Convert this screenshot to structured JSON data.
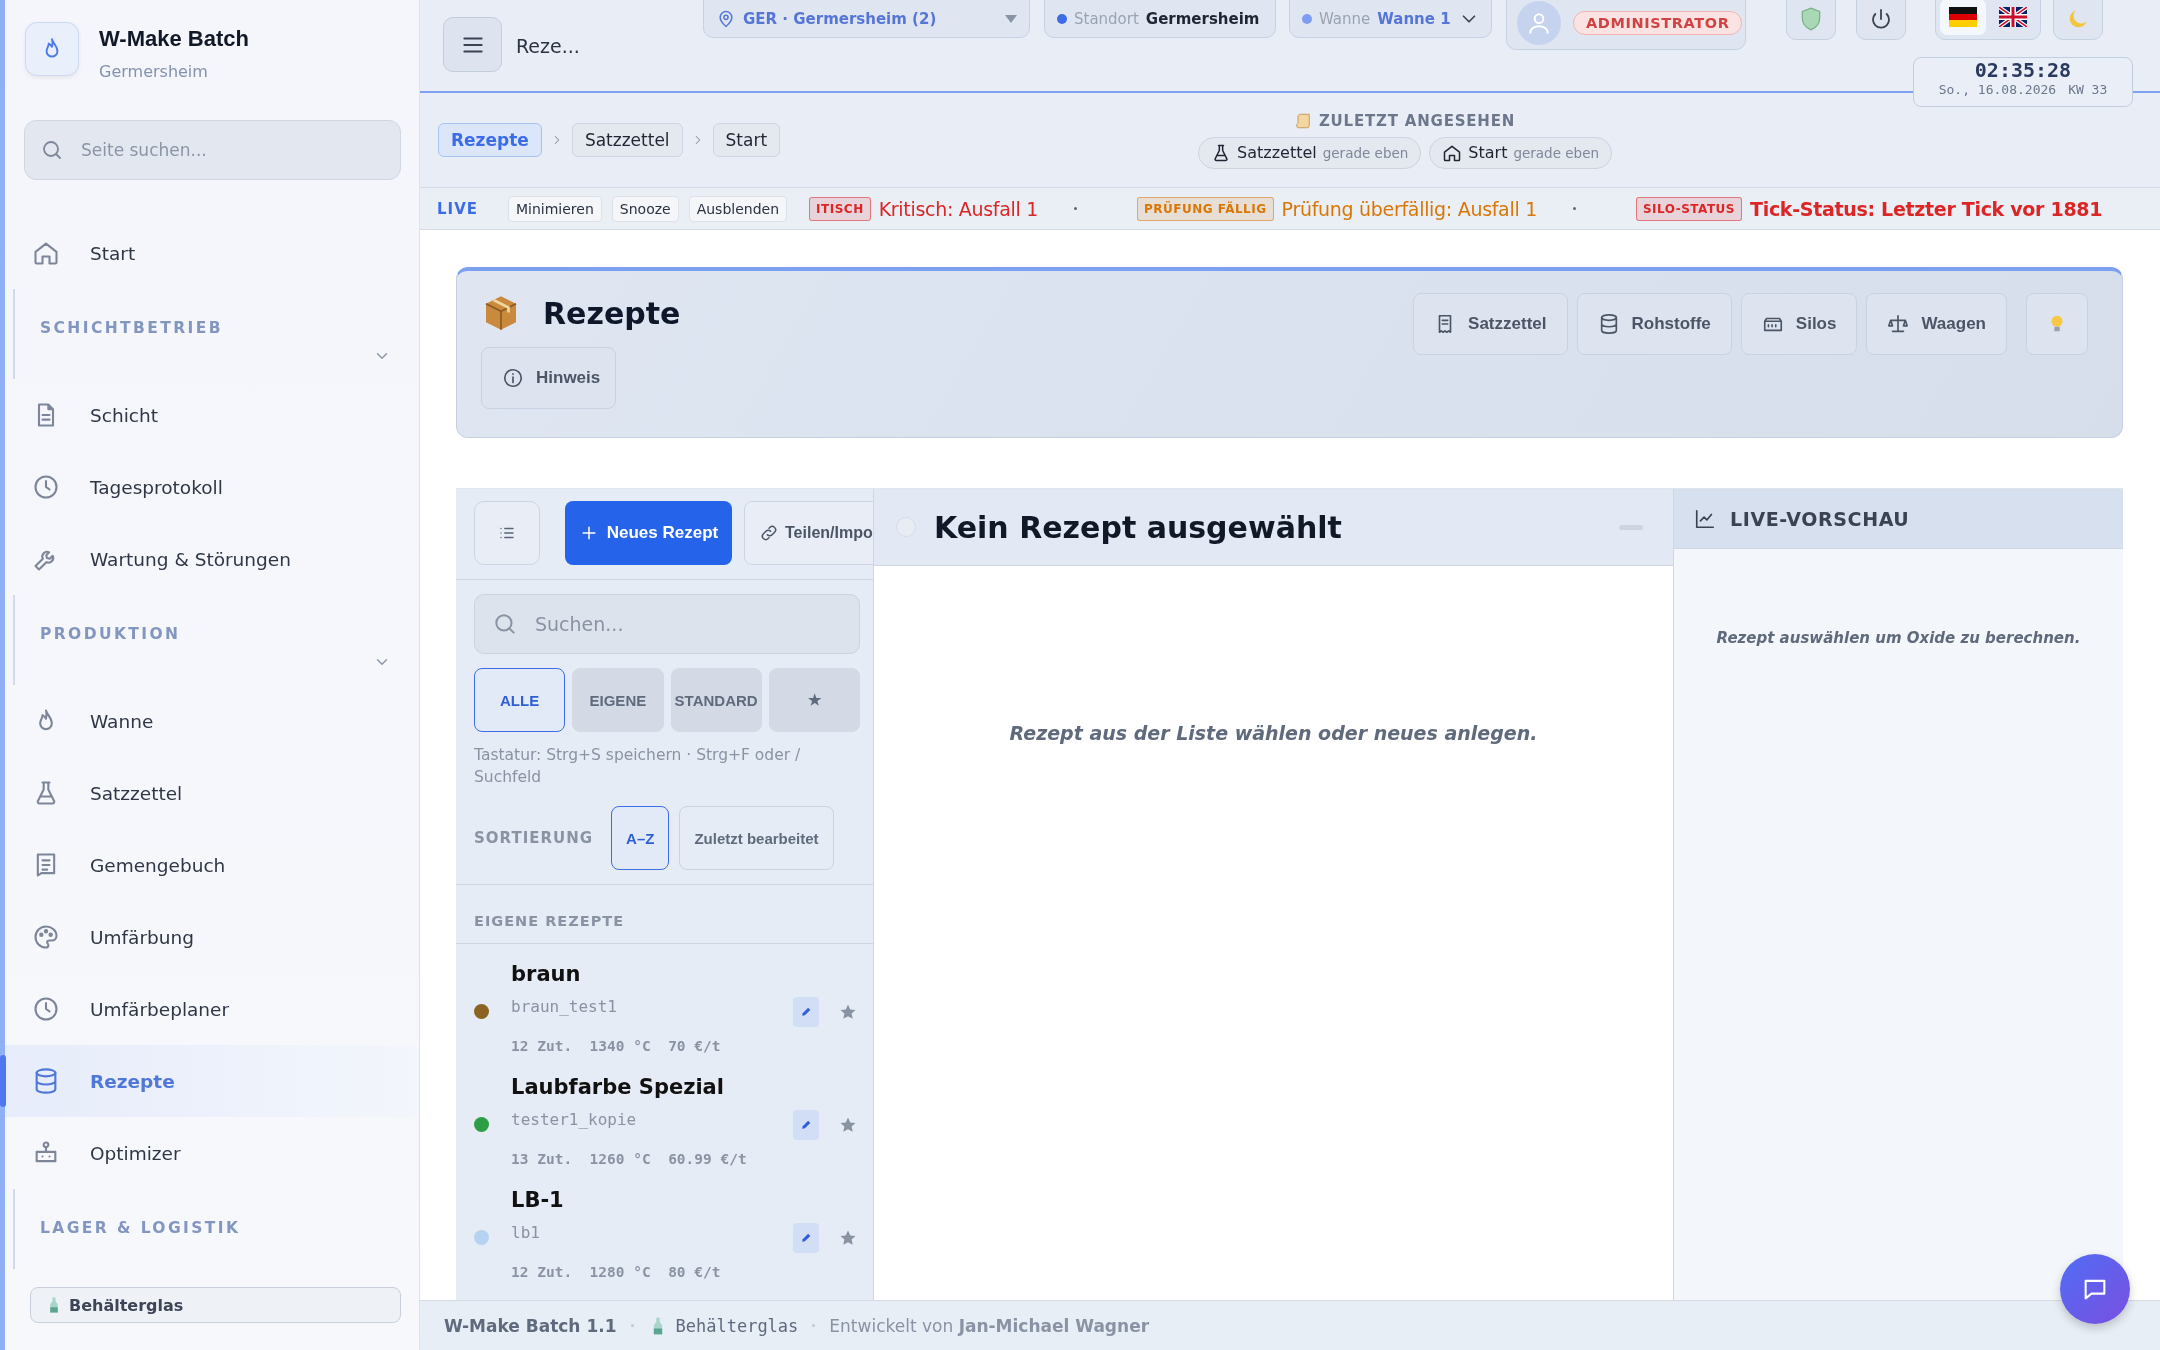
{
  "app": {
    "title": "W-Make Batch",
    "subtitle": "Germersheim"
  },
  "sidebar": {
    "search": {
      "placeholder": "Seite suchen..."
    },
    "nav": [
      {
        "kind": "link",
        "label": "Start",
        "selected": false
      },
      {
        "kind": "section",
        "label": "SCHICHTBETRIEB",
        "expanded": true
      },
      {
        "kind": "link",
        "label": "Schicht",
        "selected": false
      },
      {
        "kind": "link",
        "label": "Tagesprotokoll",
        "selected": false
      },
      {
        "kind": "link",
        "label": "Wartung & Störungen",
        "selected": false
      },
      {
        "kind": "section",
        "label": "PRODUKTION",
        "expanded": true
      },
      {
        "kind": "link",
        "label": "Wanne",
        "selected": false
      },
      {
        "kind": "link",
        "label": "Satzzettel",
        "selected": false
      },
      {
        "kind": "link",
        "label": "Gemengebuch",
        "selected": false
      },
      {
        "kind": "link",
        "label": "Umfärbung",
        "selected": false
      },
      {
        "kind": "link",
        "label": "Umfärbeplaner",
        "selected": false
      },
      {
        "kind": "link",
        "label": "Rezepte",
        "selected": true
      },
      {
        "kind": "link",
        "label": "Optimizer",
        "selected": false
      },
      {
        "kind": "section",
        "label": "LAGER & LOGISTIK",
        "expanded": false
      }
    ],
    "material_button": "Behälterglas"
  },
  "topbar": {
    "page_title": "Reze...",
    "location": "GER · Germersheim (2)",
    "standort": {
      "label": "Standort",
      "value": "Germersheim"
    },
    "wanne": {
      "label": "Wanne",
      "value": "Wanne 1"
    },
    "role": "ADMINISTRATOR",
    "languages": [
      {
        "selected": true
      },
      {
        "selected": false
      }
    ],
    "clock": {
      "time": "02:35:28",
      "date": "So., 16.08.2026",
      "week": "KW 33"
    }
  },
  "breadcrumbs": [
    {
      "label": "Rezepte",
      "selected": true
    },
    {
      "label": "Satzzettel",
      "selected": false
    },
    {
      "label": "Start",
      "selected": false
    }
  ],
  "recent": {
    "title": "ZULETZT ANGESEHEN",
    "items": [
      {
        "label": "Satzzettel",
        "time": "gerade eben"
      },
      {
        "label": "Start",
        "time": "gerade eben"
      }
    ]
  },
  "live_bar": {
    "label": "LIVE",
    "buttons": [
      "Minimieren",
      "Snooze",
      "Ausblenden"
    ],
    "alerts": [
      {
        "tag": "ITISCH",
        "text": "Kritisch: Ausfall 1",
        "color": "#dc2626",
        "bold": false
      },
      {
        "tag": "PRÜFUNG FÄLLIG",
        "text": "Prüfung überfällig: Ausfall 1",
        "color": "#d97706",
        "bold": false
      },
      {
        "tag": "SILO-STATUS",
        "text": "Tick-Status: Letzter Tick vor 1881",
        "color": "#dc2626",
        "bold": true
      }
    ]
  },
  "page_header": {
    "title": "Rezepte",
    "hint_button": "Hinweis",
    "links": [
      "Satzzettel",
      "Rohstoffe",
      "Silos",
      "Waagen"
    ]
  },
  "recipe_list": {
    "new_button": "Neues Rezept",
    "share_button": "Teilen/Impo",
    "search": {
      "placeholder": "Suchen..."
    },
    "filters": [
      {
        "label": "ALLE",
        "selected": true
      },
      {
        "label": "EIGENE",
        "selected": false
      },
      {
        "label": "STANDARD",
        "selected": false
      },
      {
        "label": "★",
        "selected": false
      }
    ],
    "hint": "Tastatur: Strg+S speichern · Strg+F oder / Suchfeld",
    "sort": {
      "label": "SORTIERUNG",
      "options": [
        {
          "label": "A–Z",
          "selected": true
        },
        {
          "label": "Zuletzt bearbeitet",
          "selected": false
        }
      ]
    },
    "group": "EIGENE REZEPTE",
    "recipes": [
      {
        "name": "braun",
        "code": "braun_test1",
        "meta": "12 Zut.  1340 °C  70 €/t",
        "color": "#8a6420"
      },
      {
        "name": "Laubfarbe Spezial",
        "code": "tester1_kopie",
        "meta": "13 Zut.  1260 °C  60.99 €/t",
        "color": "#2e9e44"
      },
      {
        "name": "LB-1",
        "code": "lb1",
        "meta": "12 Zut.  1280 °C  80 €/t",
        "color": "#b5d3f0"
      }
    ]
  },
  "editor": {
    "title": "Kein Rezept ausgewählt",
    "empty": "Rezept aus der Liste wählen oder neues anlegen."
  },
  "preview": {
    "title": "LIVE-VORSCHAU",
    "empty": "Rezept auswählen um Oxide zu berechnen."
  },
  "footer": {
    "version": "W-Make Batch 1.1",
    "material": "Behälterglas",
    "credit": "Entwickelt von **Jan-Michael Wagner**"
  }
}
